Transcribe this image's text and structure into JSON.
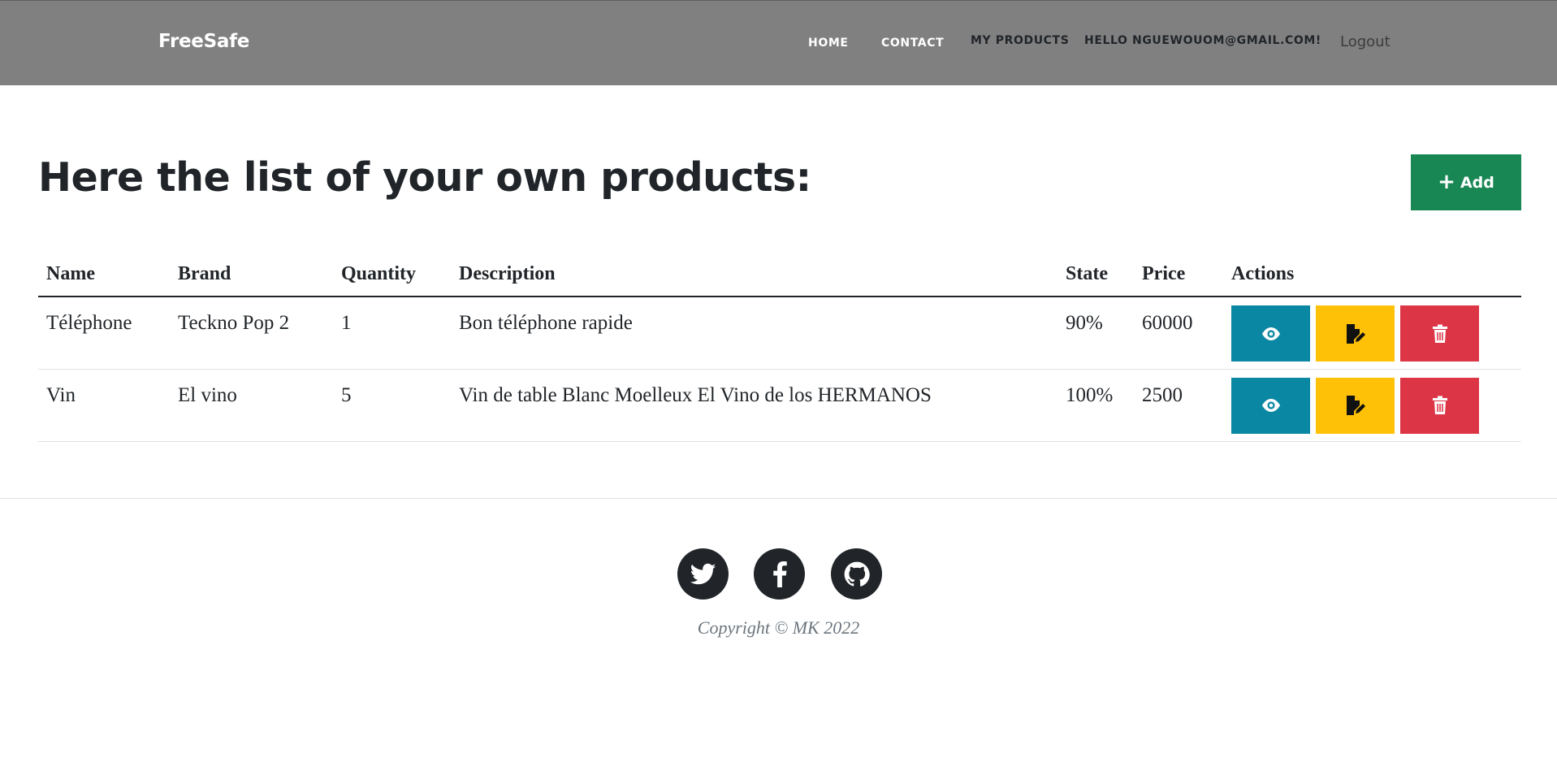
{
  "navbar": {
    "brand": "FreeSafe",
    "links": {
      "home": "HOME",
      "contact": "CONTACT",
      "my_products": "MY PRODUCTS",
      "hello": "HELLO NGUEWOUOM@GMAIL.COM!",
      "logout": "Logout"
    }
  },
  "main": {
    "title": "Here the list of your own products:",
    "add_button": {
      "icon": "plus-icon",
      "label": "Add"
    }
  },
  "table": {
    "headers": {
      "name": "Name",
      "brand": "Brand",
      "quantity": "Quantity",
      "description": "Description",
      "state": "State",
      "price": "Price",
      "actions": "Actions"
    },
    "rows": [
      {
        "name": "Téléphone",
        "brand": "Teckno Pop 2",
        "quantity": "1",
        "description": "Bon téléphone rapide",
        "state": "90%",
        "price": "60000"
      },
      {
        "name": "Vin",
        "brand": "El vino",
        "quantity": "5",
        "description": "Vin de table Blanc Moelleux El Vino de los HERMANOS",
        "state": "100%",
        "price": "2500"
      }
    ],
    "action_icons": {
      "view": "eye-icon",
      "edit": "file-edit-icon",
      "delete": "trash-icon"
    }
  },
  "footer": {
    "social_icons": [
      "twitter-icon",
      "facebook-icon",
      "github-icon"
    ],
    "copyright": "Copyright © MK 2022"
  },
  "colors": {
    "navbar_bg": "#808080",
    "add_button": "#198754",
    "view_button": "#0a87a3",
    "edit_button": "#ffc107",
    "delete_button": "#dc3545",
    "social_bg": "#212529"
  }
}
